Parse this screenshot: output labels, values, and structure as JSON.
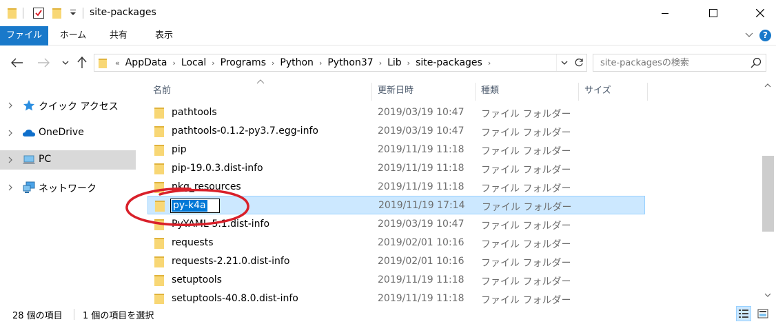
{
  "window": {
    "title": "site-packages"
  },
  "ribbon": {
    "tabs": [
      "ファイル",
      "ホーム",
      "共有",
      "表示"
    ],
    "help_label": "?"
  },
  "address": {
    "overflow": "«",
    "crumbs": [
      "AppData",
      "Local",
      "Programs",
      "Python",
      "Python37",
      "Lib",
      "site-packages"
    ],
    "separator": "›"
  },
  "search": {
    "placeholder": "site-packagesの検索"
  },
  "sidebar": {
    "items": [
      {
        "label": "クイック アクセス",
        "icon": "star-icon",
        "selected": false
      },
      {
        "label": "OneDrive",
        "icon": "cloud-icon",
        "selected": false
      },
      {
        "label": "PC",
        "icon": "computer-icon",
        "selected": true
      },
      {
        "label": "ネットワーク",
        "icon": "network-icon",
        "selected": false
      }
    ]
  },
  "columns": {
    "name": "名前",
    "date": "更新日時",
    "type": "種類",
    "size": "サイズ"
  },
  "files": [
    {
      "name": "pathtools",
      "date": "2019/03/19 10:47",
      "type": "ファイル フォルダー",
      "selected": false,
      "renaming": false
    },
    {
      "name": "pathtools-0.1.2-py3.7.egg-info",
      "date": "2019/03/19 10:47",
      "type": "ファイル フォルダー",
      "selected": false,
      "renaming": false
    },
    {
      "name": "pip",
      "date": "2019/11/19 11:18",
      "type": "ファイル フォルダー",
      "selected": false,
      "renaming": false
    },
    {
      "name": "pip-19.0.3.dist-info",
      "date": "2019/11/19 11:18",
      "type": "ファイル フォルダー",
      "selected": false,
      "renaming": false
    },
    {
      "name": "pkg_resources",
      "date": "2019/11/19 11:18",
      "type": "ファイル フォルダー",
      "selected": false,
      "renaming": false
    },
    {
      "name": "py-k4a",
      "date": "2019/11/19 17:14",
      "type": "ファイル フォルダー",
      "selected": true,
      "renaming": true
    },
    {
      "name": "PyYAML-5.1.dist-info",
      "date": "2019/03/19 10:47",
      "type": "ファイル フォルダー",
      "selected": false,
      "renaming": false
    },
    {
      "name": "requests",
      "date": "2019/02/01 10:16",
      "type": "ファイル フォルダー",
      "selected": false,
      "renaming": false
    },
    {
      "name": "requests-2.21.0.dist-info",
      "date": "2019/02/01 10:16",
      "type": "ファイル フォルダー",
      "selected": false,
      "renaming": false
    },
    {
      "name": "setuptools",
      "date": "2019/11/19 11:18",
      "type": "ファイル フォルダー",
      "selected": false,
      "renaming": false
    },
    {
      "name": "setuptools-40.8.0.dist-info",
      "date": "2019/11/19 11:18",
      "type": "ファイル フォルダー",
      "selected": false,
      "renaming": false
    }
  ],
  "status": {
    "item_count": "28 個の項目",
    "selected_count": "1 個の項目を選択"
  },
  "colors": {
    "accent": "#1979ca",
    "folder": "#f8d775",
    "folder_dark": "#e0b33c",
    "selection": "#cce8ff",
    "annotation": "#d9202a"
  }
}
